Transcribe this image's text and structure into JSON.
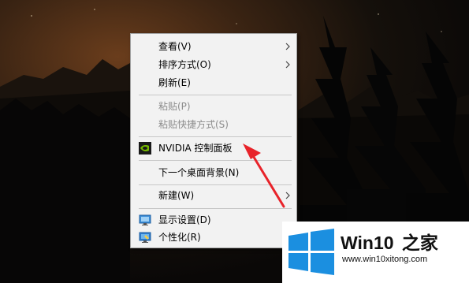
{
  "context_menu": {
    "items": [
      {
        "label": "查看(V)",
        "submenu": true,
        "enabled": true
      },
      {
        "label": "排序方式(O)",
        "submenu": true,
        "enabled": true
      },
      {
        "label": "刷新(E)",
        "submenu": false,
        "enabled": true
      },
      {
        "label": "粘贴(P)",
        "submenu": false,
        "enabled": false
      },
      {
        "label": "粘贴快捷方式(S)",
        "submenu": false,
        "enabled": false
      },
      {
        "label": "NVIDIA 控制面板",
        "submenu": false,
        "enabled": true,
        "icon": "nvidia-icon"
      },
      {
        "label": "下一个桌面背景(N)",
        "submenu": false,
        "enabled": true
      },
      {
        "label": "新建(W)",
        "submenu": true,
        "enabled": true
      },
      {
        "label": "显示设置(D)",
        "submenu": false,
        "enabled": true,
        "icon": "display-settings-icon"
      },
      {
        "label": "个性化(R)",
        "submenu": false,
        "enabled": true,
        "icon": "personalize-icon"
      }
    ]
  },
  "watermark": {
    "brand_prefix": "Win10",
    "brand_suffix": "之家",
    "url": "www.win10xitong.com",
    "logo_color": "#1b8fe0"
  },
  "colors": {
    "annotation_arrow": "#e8232a",
    "menu_background": "#f2f2f2",
    "disabled_text": "#8c8c8c"
  }
}
